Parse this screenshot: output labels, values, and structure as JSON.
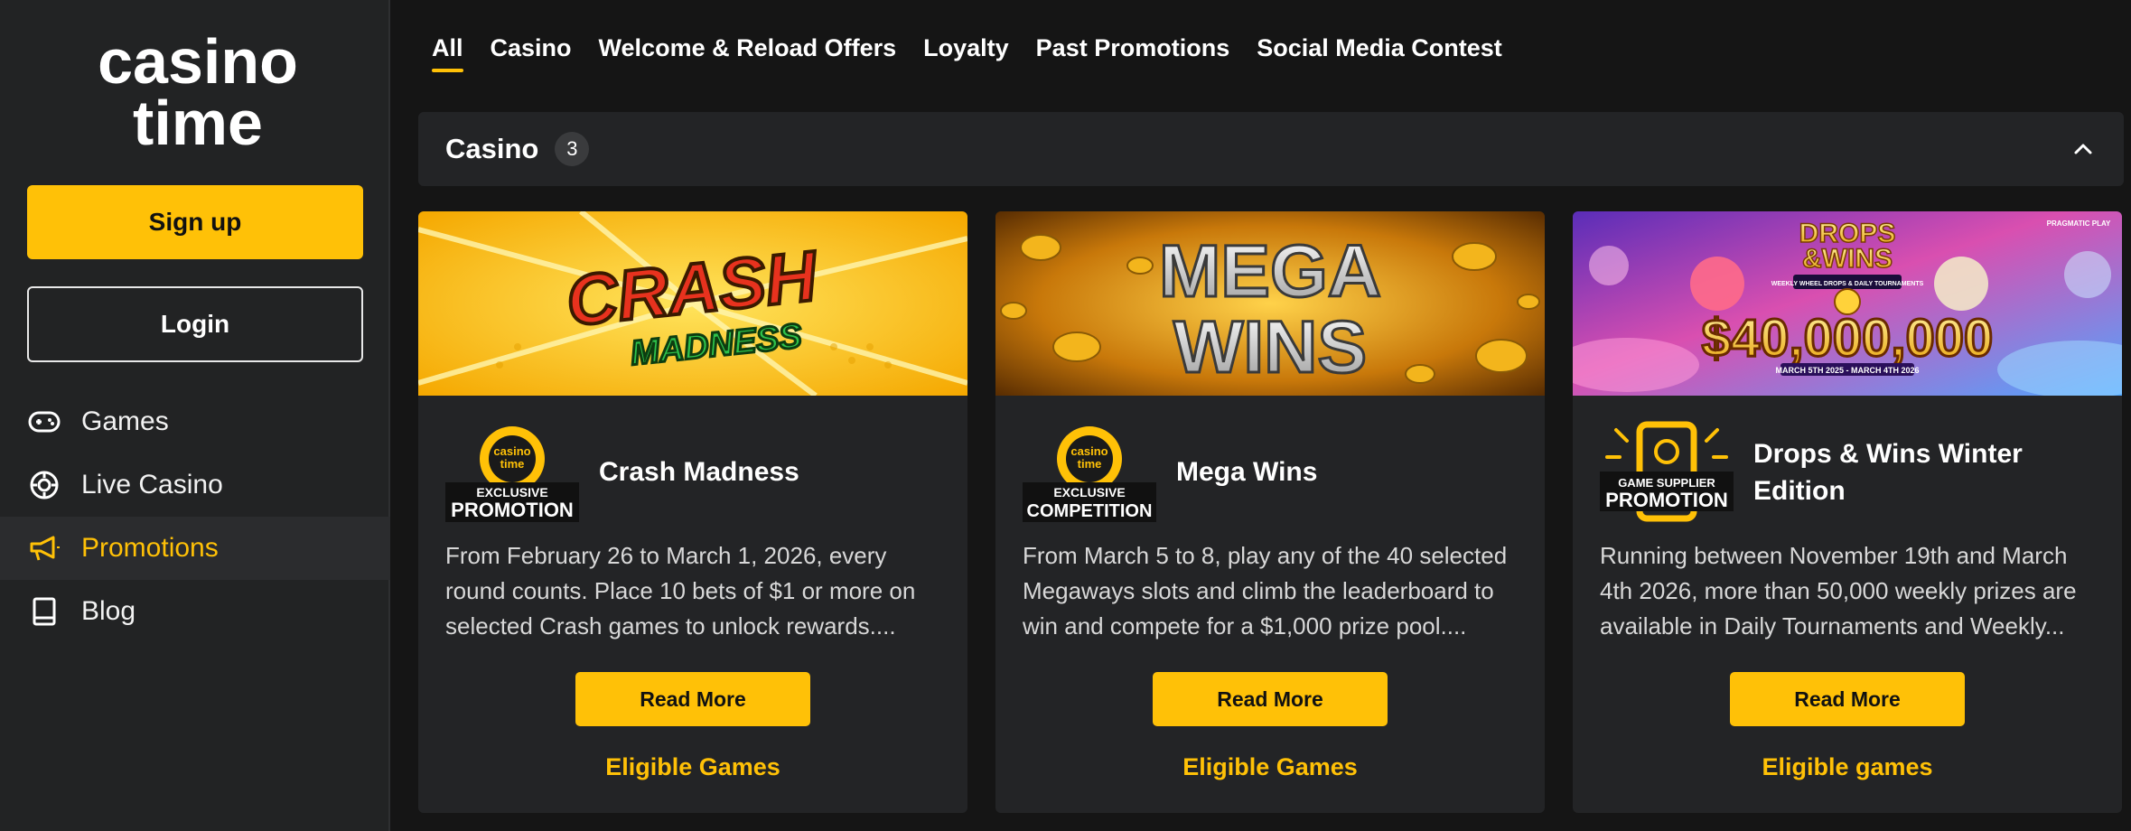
{
  "brand": {
    "logo_line1": "casino",
    "logo_line2": "time",
    "accent": "#ffc107"
  },
  "sidebar": {
    "signup_label": "Sign up",
    "login_label": "Login",
    "items": [
      {
        "label": "Games",
        "icon": "gamepad-icon"
      },
      {
        "label": "Live Casino",
        "icon": "casino-chip-icon"
      },
      {
        "label": "Promotions",
        "icon": "megaphone-icon",
        "active": true
      },
      {
        "label": "Blog",
        "icon": "book-icon"
      }
    ]
  },
  "tabs": [
    {
      "label": "All",
      "active": true
    },
    {
      "label": "Casino"
    },
    {
      "label": "Welcome & Reload Offers"
    },
    {
      "label": "Loyalty"
    },
    {
      "label": "Past Promotions"
    },
    {
      "label": "Social Media Contest"
    }
  ],
  "section": {
    "title": "Casino",
    "count": "3"
  },
  "cards": [
    {
      "banner_text_1": "CRASH",
      "banner_text_2": "MADNESS",
      "badge_logo_1": "casino",
      "badge_logo_2": "time",
      "badge_small": "EXCLUSIVE",
      "badge_big": "PROMOTION",
      "title": "Crash Madness",
      "description": "From February 26 to March 1, 2026, every round counts. Place 10 bets of $1 or more on selected Crash games to unlock rewards....",
      "read_more": "Read More",
      "eligible": "Eligible Games"
    },
    {
      "banner_text_1": "MEGA",
      "banner_text_2": "WINS",
      "badge_logo_1": "casino",
      "badge_logo_2": "time",
      "badge_small": "EXCLUSIVE",
      "badge_big": "COMPETITION",
      "title": "Mega Wins",
      "description": "From March 5 to 8, play any of the 40 selected Megaways slots and climb the leaderboard to win and compete for a $1,000 prize pool....",
      "read_more": "Read More",
      "eligible": "Eligible Games"
    },
    {
      "banner_text_1": "DROPS",
      "banner_text_2": "&WINS",
      "banner_text_3": "WEEKLY WHEEL DROPS & DAILY TOURNAMENTS",
      "banner_text_4": "$40,000,000",
      "banner_text_5": "MARCH 5TH 2025 - MARCH 4TH 2026",
      "banner_text_6": "PRAGMATIC PLAY",
      "badge_small": "GAME SUPPLIER",
      "badge_big": "PROMOTION",
      "title": "Drops & Wins Winter Edition",
      "description": "Running between November 19th and March 4th 2026, more than 50,000 weekly prizes are available in Daily Tournaments and Weekly...",
      "read_more": "Read More",
      "eligible": "Eligible games"
    }
  ]
}
